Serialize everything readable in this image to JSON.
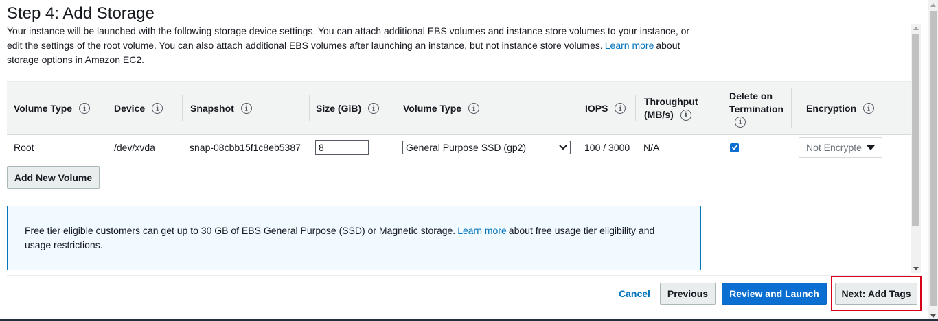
{
  "page": {
    "title": "Step 4: Add Storage",
    "description_part1": "Your instance will be launched with the following storage device settings. You can attach additional EBS volumes and instance store volumes to your instance, or edit the settings of the root volume. You can also attach additional EBS volumes after launching an instance, but not instance store volumes.",
    "learn_more": "Learn more",
    "description_part2": "about storage options in Amazon EC2."
  },
  "table": {
    "headers": {
      "volume_type": "Volume Type",
      "device": "Device",
      "snapshot": "Snapshot",
      "size": "Size (GiB)",
      "volume_type2": "Volume Type",
      "iops": "IOPS",
      "throughput_line1": "Throughput",
      "throughput_line2": "(MB/s)",
      "delete_line1": "Delete on",
      "delete_line2": "Termination",
      "encryption": "Encryption"
    },
    "rows": [
      {
        "volume_type": "Root",
        "device": "/dev/xvda",
        "snapshot": "snap-08cbb15f1c8eb5387",
        "size": "8",
        "ebs_volume_type": "General Purpose SSD (gp2)",
        "iops": "100 / 3000",
        "throughput": "N/A",
        "delete_on_termination": true,
        "encryption": "Not Encrypte"
      }
    ]
  },
  "add_volume_button": "Add New Volume",
  "info_box": {
    "text_part1": "Free tier eligible customers can get up to 30 GB of EBS General Purpose (SSD) or Magnetic storage.",
    "learn_more": "Learn more",
    "text_part2": "about free usage tier eligibility and usage restrictions."
  },
  "footer": {
    "cancel": "Cancel",
    "previous": "Previous",
    "review_launch": "Review and Launch",
    "next": "Next: Add Tags"
  },
  "icons": {
    "info": "i"
  },
  "colors": {
    "primary": "#0a6fd1",
    "link": "#0073bb",
    "highlight": "#d9001b"
  }
}
